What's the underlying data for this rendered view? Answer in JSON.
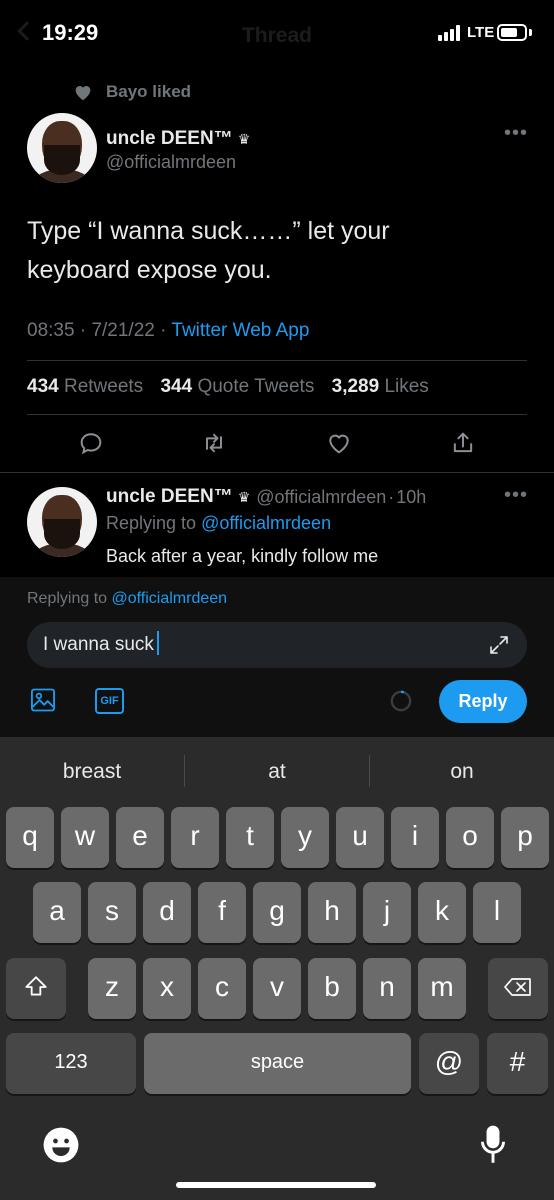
{
  "status_bar": {
    "time": "19:29",
    "network": "LTE"
  },
  "nav": {
    "title": "Thread"
  },
  "liked_header": {
    "text": "Bayo liked"
  },
  "main_tweet": {
    "name": "uncle DEEN™",
    "crown": "♛",
    "handle": "@officialmrdeen",
    "text_line1": "Type “I wanna suck……” let your",
    "text_line2": "keyboard expose you.",
    "time": "08:35",
    "date": "7/21/22",
    "source": "Twitter Web App",
    "retweets_count": "434",
    "retweets_label": "Retweets",
    "quotes_count": "344",
    "quotes_label": "Quote Tweets",
    "likes_count": "3,289",
    "likes_label": "Likes"
  },
  "reply_tweet": {
    "name": "uncle DEEN™",
    "crown": "♛",
    "handle": "@officialmrdeen",
    "age": "10h",
    "replying_prefix": "Replying to",
    "replying_handle": "@officialmrdeen",
    "text": "Back after a year, kindly follow me"
  },
  "composer": {
    "replying_prefix": "Replying to",
    "replying_handle": "@officialmrdeen",
    "input_value": "I wanna suck",
    "gif_label": "GIF",
    "reply_button": "Reply"
  },
  "keyboard": {
    "suggestions": [
      "breast",
      "at",
      "on"
    ],
    "row1": [
      "q",
      "w",
      "e",
      "r",
      "t",
      "y",
      "u",
      "i",
      "o",
      "p"
    ],
    "row2": [
      "a",
      "s",
      "d",
      "f",
      "g",
      "h",
      "j",
      "k",
      "l"
    ],
    "row3": [
      "z",
      "x",
      "c",
      "v",
      "b",
      "n",
      "m"
    ],
    "numbers_key": "123",
    "space_key": "space",
    "at_key": "@",
    "hash_key": "#"
  },
  "colors": {
    "accent": "#1d9bf0",
    "background": "#000000",
    "keyboard_bg": "#2b2b2b",
    "key_bg": "#6b6b6b",
    "muted": "#71767b"
  }
}
